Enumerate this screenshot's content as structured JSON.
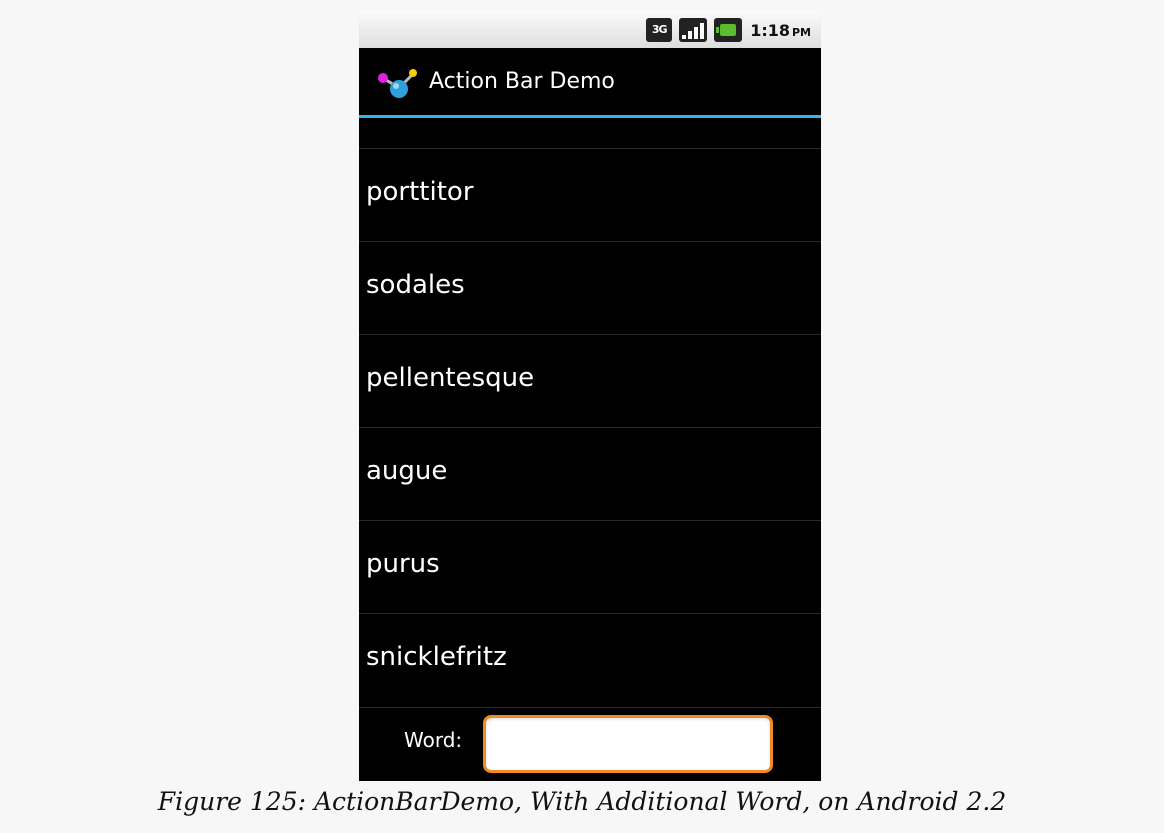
{
  "status_bar": {
    "time": "1:18",
    "ampm": "PM",
    "network_label": "3G",
    "icons": [
      "3g-network-icon",
      "signal-strength-icon",
      "battery-charging-icon"
    ]
  },
  "action_bar": {
    "title": "Action Bar Demo",
    "app_icon": "molecule-app-icon",
    "accent_color": "#33b5e5"
  },
  "list": {
    "items": [
      "porttitor",
      "sodales",
      "pellentesque",
      "augue",
      "purus",
      "snicklefritz"
    ]
  },
  "input": {
    "label": "Word:",
    "value": "",
    "focus_color": "#f08a24"
  },
  "caption": "Figure 125: ActionBarDemo, With Additional Word, on Android 2.2"
}
